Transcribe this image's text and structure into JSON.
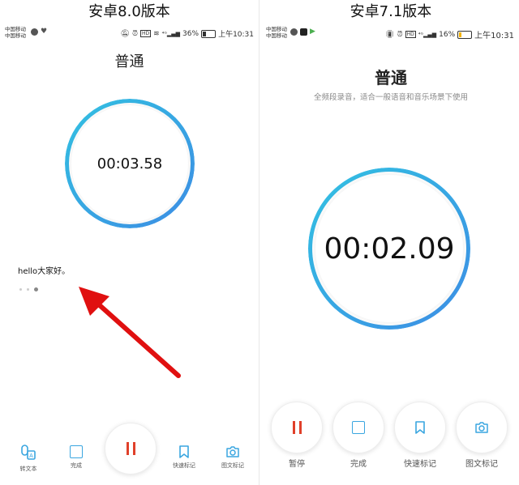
{
  "left": {
    "caption": "安卓8.0版本",
    "status": {
      "carrier1": "中国移动",
      "carrier2": "中国移动",
      "battery": "36%",
      "time": "上午10:31"
    },
    "title": "普通",
    "timer": "00:03.58",
    "transcript": "hello大家好。",
    "buttons": {
      "to_text": "转文本",
      "done": "完成",
      "quick_mark": "快速标记",
      "photo_mark": "图文标记"
    }
  },
  "right": {
    "caption": "安卓7.1版本",
    "status": {
      "carrier1": "中国移动",
      "carrier2": "中国移动",
      "battery": "16%",
      "time": "上午10:31"
    },
    "title": "普通",
    "subtitle": "全频段录音，适合一般语音和音乐场景下使用",
    "timer": "00:02.09",
    "buttons": {
      "pause": "暂停",
      "done": "完成",
      "quick_mark": "快速标记",
      "photo_mark": "图文标记"
    }
  },
  "colors": {
    "accent": "#3aa6e0",
    "pause_red": "#e0402a",
    "arrow_red": "#e01010"
  },
  "icons": [
    "mute-icon",
    "alarm-icon",
    "hd-icon",
    "wifi-icon",
    "signal-icon",
    "battery-icon",
    "vibrate-icon",
    "pause-icon",
    "stop-icon",
    "bookmark-icon",
    "camera-icon",
    "voice-to-text-icon"
  ]
}
